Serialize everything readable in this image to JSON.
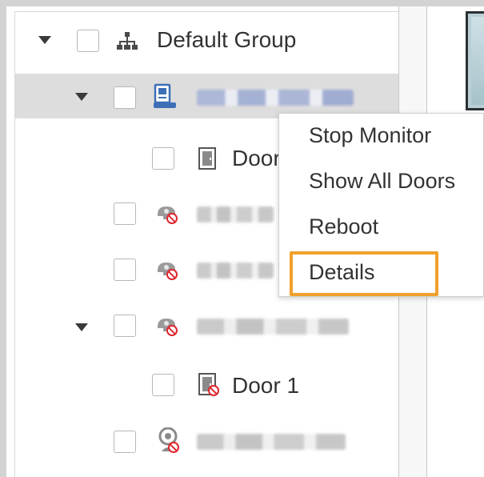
{
  "tree": {
    "root": {
      "label": "Default Group",
      "expanded": true,
      "icon": "org-tree-icon"
    },
    "items": [
      {
        "label": "",
        "icon": "access-controller-icon",
        "expanded": true,
        "selected": true,
        "status": "online",
        "name_obscured": true
      },
      {
        "label": "Door",
        "icon": "door-icon",
        "status": "online"
      },
      {
        "label": "",
        "icon": "offline-camera-icon",
        "status": "offline",
        "name_obscured": true
      },
      {
        "label": "",
        "icon": "offline-camera-icon",
        "status": "offline",
        "name_obscured": true
      },
      {
        "label": "",
        "icon": "offline-camera-icon",
        "status": "offline",
        "expanded": true,
        "name_obscured": true
      },
      {
        "label": "Door 1",
        "icon": "door-offline-icon",
        "status": "offline"
      },
      {
        "label": "",
        "icon": "offline-webcam-icon",
        "status": "offline",
        "name_obscured": true
      }
    ]
  },
  "context_menu": {
    "items": [
      {
        "label": "Stop Monitor"
      },
      {
        "label": "Show All Doors"
      },
      {
        "label": "Reboot"
      },
      {
        "label": "Details",
        "highlighted": true
      }
    ]
  },
  "colors": {
    "highlight_border": "#f0a02b",
    "selected_row": "#dddddd",
    "offline_badge": "#e0262f",
    "device_icon_blue": "#3d6fb6"
  }
}
